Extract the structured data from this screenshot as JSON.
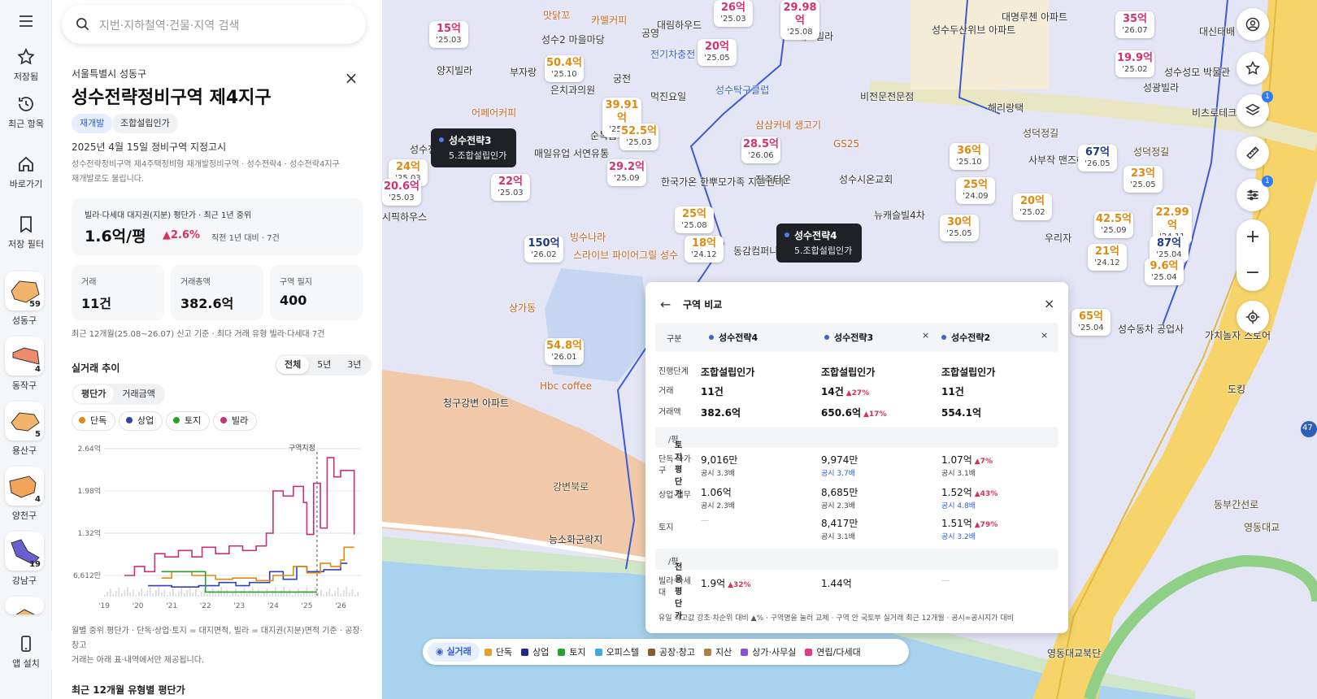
{
  "rail": {
    "menu_icon": "menu-icon",
    "items": [
      {
        "icon": "star-icon",
        "label": "저장됨"
      },
      {
        "icon": "history-icon",
        "label": "최근 항목"
      },
      {
        "icon": "home-icon",
        "label": "바로가기"
      },
      {
        "icon": "bookmark-icon",
        "label": "저장 필터"
      }
    ],
    "regions": [
      {
        "label": "성동구",
        "count": "59",
        "color": "#f2b46a"
      },
      {
        "label": "동작구",
        "count": "4",
        "color": "#f08a6c"
      },
      {
        "label": "용산구",
        "count": "5",
        "color": "#f2b46a"
      },
      {
        "label": "양천구",
        "count": "4",
        "color": "#f2a45a"
      },
      {
        "label": "강남구",
        "count": "19",
        "color": "#6a5fd0"
      }
    ],
    "app_install": "앱 설치"
  },
  "search": {
    "placeholder": "지번·지하철역·건물·지역 검색"
  },
  "detail": {
    "region": "서울특별시 성동구",
    "title": "성수전략정비구역 제4지구",
    "tags": [
      "재개발",
      "조합설립인가"
    ],
    "designated": "2025년 4월 15일 정비구역 지정고시",
    "alias_line1": "성수전략정비구역 제4주택정비형 재개발정비구역 · 성수전략4 · 성수전략4지구",
    "alias_line2": "재개발로도 불립니다.",
    "price_label": "빌라·다세대 대지권(지분) 평단가 · 최근 1년 중위",
    "price_value": "1.6억/평",
    "price_change": "▲2.6%",
    "price_compare": "직전 1년 대비 · 7건",
    "stats": [
      {
        "label": "거래",
        "value": "11건"
      },
      {
        "label": "거래총액",
        "value": "382.6억"
      },
      {
        "label": "구역 필지",
        "value": "400"
      }
    ],
    "note": "최근 12개월(25.08~26.07) 신고 기준 · 최다 거래 유형 빌라·다세대 7건",
    "trend_title": "실거래 추이",
    "period_tabs": [
      "전체",
      "5년",
      "3년"
    ],
    "metric_tabs": [
      "평단가",
      "거래금액"
    ],
    "legend": [
      {
        "name": "단독",
        "color": "#e08a0e"
      },
      {
        "name": "상업",
        "color": "#3340b8"
      },
      {
        "name": "토지",
        "color": "#2aa12a"
      },
      {
        "name": "빌라",
        "color": "#c8307a"
      }
    ],
    "foot_line1": "월별 중위 평단가 · 단독·상업·토지 = 대지면적, 빌라 = 대지권(지분)면적 기준 · 공장·창고",
    "foot_line2": "거래는 아래 표·내역에서만 제공됩니다.",
    "bottom_heading": "최근 12개월 유형별 평단가"
  },
  "chart_data": {
    "type": "line",
    "x_ticks": [
      "'19",
      "'20",
      "'21",
      "'22",
      "'23",
      "'24",
      "'25",
      "'26"
    ],
    "y_ticks": [
      "2.64억",
      "1.98억",
      "1.32억",
      "6,612만"
    ],
    "ylim": [
      0.33,
      2.64
    ],
    "annotation": "구역지정",
    "annotation_x": 2025.3,
    "series": [
      {
        "name": "빌라",
        "color": "#c8307a",
        "points": [
          [
            2019.6,
            0.66
          ],
          [
            2019.9,
            0.8
          ],
          [
            2020.2,
            0.72
          ],
          [
            2020.5,
            1.0
          ],
          [
            2020.8,
            0.95
          ],
          [
            2021.2,
            1.05
          ],
          [
            2021.6,
            0.95
          ],
          [
            2021.9,
            1.1
          ],
          [
            2022.3,
            1.0
          ],
          [
            2022.7,
            1.12
          ],
          [
            2023.1,
            1.05
          ],
          [
            2023.5,
            1.12
          ],
          [
            2023.8,
            1.32
          ],
          [
            2024.0,
            1.98
          ],
          [
            2024.3,
            1.9
          ],
          [
            2024.6,
            2.05
          ],
          [
            2024.9,
            1.8
          ],
          [
            2025.0,
            1.3
          ],
          [
            2025.2,
            2.1
          ],
          [
            2025.4,
            1.4
          ],
          [
            2025.6,
            2.5
          ],
          [
            2025.8,
            2.2
          ],
          [
            2026.0,
            2.3
          ],
          [
            2026.3,
            2.3
          ],
          [
            2026.4,
            1.3
          ]
        ]
      },
      {
        "name": "상업",
        "color": "#3340b8",
        "points": [
          [
            2020.3,
            0.5
          ],
          [
            2021.0,
            0.48
          ],
          [
            2021.8,
            0.5
          ],
          [
            2022.4,
            0.55
          ],
          [
            2022.9,
            0.5
          ],
          [
            2023.3,
            0.55
          ],
          [
            2023.9,
            0.72
          ],
          [
            2024.3,
            0.6
          ],
          [
            2024.7,
            0.8
          ],
          [
            2025.0,
            0.72
          ],
          [
            2025.5,
            0.75
          ],
          [
            2026.0,
            0.85
          ],
          [
            2026.2,
            0.85
          ]
        ]
      },
      {
        "name": "단독",
        "color": "#e08a0e",
        "points": [
          [
            2020.7,
            0.62
          ],
          [
            2021.0,
            0.72
          ],
          [
            2021.6,
            0.66
          ],
          [
            2022.3,
            0.6
          ],
          [
            2022.8,
            0.62
          ],
          [
            2023.5,
            0.58
          ],
          [
            2024.0,
            0.66
          ],
          [
            2024.6,
            0.8
          ],
          [
            2025.0,
            0.7
          ],
          [
            2025.4,
            0.85
          ],
          [
            2025.7,
            0.8
          ],
          [
            2026.0,
            0.9
          ],
          [
            2026.1,
            1.1
          ],
          [
            2026.4,
            1.1
          ]
        ]
      },
      {
        "name": "토지",
        "color": "#2aa12a",
        "points": [
          [
            2020.7,
            0.72
          ],
          [
            2021.4,
            0.72
          ],
          [
            2021.9,
            0.72
          ],
          [
            2022.0,
            0.4
          ],
          [
            2024.1,
            0.4
          ],
          [
            2025.3,
            0.4
          ]
        ]
      }
    ]
  },
  "map": {
    "places": [
      {
        "t": "양지빌라",
        "c": ""
      },
      {
        "t": "부자랑",
        "c": ""
      },
      {
        "t": "성수2 마을마당",
        "c": ""
      },
      {
        "t": "공영",
        "c": ""
      },
      {
        "t": "대림하우드",
        "c": ""
      },
      {
        "t": "대보빌라",
        "c": ""
      },
      {
        "t": "전기차충전",
        "c": "blue"
      },
      {
        "t": "궁전",
        "c": ""
      },
      {
        "t": "은치과의원",
        "c": ""
      },
      {
        "t": "먹진요일",
        "c": ""
      },
      {
        "t": "성수탁구클럽",
        "c": "blue"
      },
      {
        "t": "어페어커피",
        "c": "orange"
      },
      {
        "t": "매일유업 서연유통",
        "c": ""
      },
      {
        "t": "한국가온 한뿌모가족 지원센터",
        "c": ""
      },
      {
        "t": "진주타운",
        "c": ""
      },
      {
        "t": "성수시온교회",
        "c": ""
      },
      {
        "t": "뉴캐슬빌4차",
        "c": ""
      },
      {
        "t": "비전문전문점",
        "c": ""
      },
      {
        "t": "해리랑택",
        "c": ""
      },
      {
        "t": "성덕정길",
        "c": "road"
      },
      {
        "t": "사부작 맨즈헤어",
        "c": ""
      },
      {
        "t": "동감컴퍼니",
        "c": ""
      },
      {
        "t": "빙수나라",
        "c": "orange"
      },
      {
        "t": "상가동",
        "c": "orange"
      },
      {
        "t": "청구강변 아파트",
        "c": ""
      },
      {
        "t": "Hbc coffee",
        "c": "orange"
      },
      {
        "t": "강변북로",
        "c": "road"
      },
      {
        "t": "능소화군락지",
        "c": ""
      },
      {
        "t": "유원연",
        "c": ""
      },
      {
        "t": "대명루첸 아파트",
        "c": ""
      },
      {
        "t": "성수두산위브 아파트",
        "c": ""
      },
      {
        "t": "대신태배",
        "c": ""
      },
      {
        "t": "성수성모 박물관",
        "c": ""
      },
      {
        "t": "성광빌라",
        "c": ""
      },
      {
        "t": "비츠로테크",
        "c": ""
      },
      {
        "t": "성덕정길",
        "c": "road"
      },
      {
        "t": "우리자",
        "c": ""
      },
      {
        "t": "가치놀자 스토어",
        "c": ""
      },
      {
        "t": "동부간선로",
        "c": "road"
      },
      {
        "t": "영동대교북단",
        "c": ""
      },
      {
        "t": "성수동차 공업사",
        "c": ""
      },
      {
        "t": "GS25",
        "c": "orange"
      },
      {
        "t": "카멜커피",
        "c": "orange"
      },
      {
        "t": "맛닭꼬",
        "c": "orange"
      },
      {
        "t": "삼삼커네 생고기",
        "c": "orange"
      },
      {
        "t": "스라이브 파이어그릴 성수",
        "c": "orange"
      },
      {
        "t": "순복음 하나교회",
        "c": ""
      },
      {
        "t": "성수전략비구",
        "c": ""
      },
      {
        "t": "시픽하우스",
        "c": ""
      },
      {
        "t": "영동대교",
        "c": "road"
      },
      {
        "t": "도킹",
        "c": ""
      }
    ],
    "pins": [
      {
        "v": "15억",
        "d": "'25.03",
        "c": "pink"
      },
      {
        "v": "29.98억",
        "d": "'25.08",
        "c": "pink"
      },
      {
        "v": "26억",
        "d": "'25.03",
        "c": "pink"
      },
      {
        "v": "50.4억",
        "d": "'25.10",
        "c": "orange"
      },
      {
        "v": "20억",
        "d": "'25.05",
        "c": "pink"
      },
      {
        "v": "39.91억",
        "d": "'25.06",
        "c": "orange"
      },
      {
        "v": "52.5억",
        "d": "'25.03",
        "c": "orange"
      },
      {
        "v": "28.5억",
        "d": "'26.06",
        "c": "pink"
      },
      {
        "v": "29.2억",
        "d": "'25.09",
        "c": "pink"
      },
      {
        "v": "24억",
        "d": "'25.03",
        "c": "orange"
      },
      {
        "v": "20.6억",
        "d": "'25.03",
        "c": "pink"
      },
      {
        "v": "22억",
        "d": "'25.03",
        "c": "pink"
      },
      {
        "v": "25억",
        "d": "'25.08",
        "c": "orange"
      },
      {
        "v": "18억",
        "d": "'24.12",
        "c": "orange"
      },
      {
        "v": "150억",
        "d": "'26.02",
        "c": "navy"
      },
      {
        "v": "54.8억",
        "d": "'26.01",
        "c": "orange"
      },
      {
        "v": "36억",
        "d": "'25.10",
        "c": "orange"
      },
      {
        "v": "67억",
        "d": "'26.05",
        "c": "navy"
      },
      {
        "v": "25억",
        "d": "'24.09",
        "c": "orange"
      },
      {
        "v": "20억",
        "d": "'25.02",
        "c": "orange"
      },
      {
        "v": "30억",
        "d": "'25.05",
        "c": "orange"
      },
      {
        "v": "42.5억",
        "d": "'25.09",
        "c": "orange"
      },
      {
        "v": "23억",
        "d": "'25.05",
        "c": "orange"
      },
      {
        "v": "22.99억",
        "d": "'24.11",
        "c": "orange"
      },
      {
        "v": "21억",
        "d": "'24.12",
        "c": "orange"
      },
      {
        "v": "87억",
        "d": "'25.04",
        "c": "navy"
      },
      {
        "v": "9.6억",
        "d": "'25.04",
        "c": "orange"
      },
      {
        "v": "35억",
        "d": "'26.07",
        "c": "pink"
      },
      {
        "v": "19.9억",
        "d": "'25.02",
        "c": "pink"
      },
      {
        "v": "65억",
        "d": "'25.04",
        "c": "orange"
      }
    ],
    "tips": [
      {
        "name": "성수전략3",
        "sub": "5.조합설립인가"
      },
      {
        "name": "성수전략4",
        "sub": "5.조합설립인가"
      }
    ],
    "road_badge": "47"
  },
  "tools": [
    "user-icon",
    "star-icon",
    "layers-icon",
    "ruler-icon",
    "filter-icon",
    "locate-icon"
  ],
  "zoom": {
    "in": "+",
    "out": "−"
  },
  "compare": {
    "title": "구역 비교",
    "col_head": "구분",
    "cols": [
      "성수전략4",
      "성수전략3",
      "성수전략2"
    ],
    "stage_label": "진행단계",
    "stage": [
      "조합설립인가",
      "조합설립인가",
      "조합설립인가"
    ],
    "deals_label": "거래",
    "deals": [
      "11건",
      "14건",
      "11건"
    ],
    "deals_up": [
      "",
      "▲27%",
      ""
    ],
    "amount_label": "거래액",
    "amount": [
      "382.6억",
      "650.6억",
      "554.1억"
    ],
    "amount_up": [
      "",
      "▲17%",
      ""
    ],
    "land_sec": "토지 평단가",
    "land_unit": "/평",
    "rows": [
      {
        "label": "단독·다가구",
        "v": [
          "9,016만",
          "9,974만",
          "1.07억"
        ],
        "up": [
          "",
          "",
          "▲7%"
        ],
        "s": [
          "공시 3.3배",
          "공시 3.7배",
          "공시 3.1배"
        ]
      },
      {
        "label": "상업·업무",
        "v": [
          "1.06억",
          "8,685만",
          "1.52억"
        ],
        "up": [
          "",
          "",
          "▲43%"
        ],
        "s": [
          "공시 2.3배",
          "공시 2.3배",
          "공시 4.8배"
        ]
      },
      {
        "label": "토지",
        "v": [
          "—",
          "8,417만",
          "1.51억"
        ],
        "up": [
          "",
          "",
          "▲79%"
        ],
        "s": [
          "",
          "공시 3.1배",
          "공시 3.2배"
        ]
      }
    ],
    "excl_sec": "전용 평단가",
    "excl_unit": "/평",
    "villa_label": "빌라·다세대",
    "villa": [
      "1.9억",
      "1.44억",
      "—"
    ],
    "villa_up": [
      "▲32%",
      "",
      ""
    ],
    "footnote": "유일 최고값 강조·차순위 대비 ▲% · 구역명을 눌러 교체 · 구역 안 국토부 실거래 최근 12개월 · 공시=공시지가 대비"
  },
  "legend_bar": {
    "live": "실거래",
    "items": [
      {
        "name": "단독",
        "color": "#e8a02a"
      },
      {
        "name": "상업",
        "color": "#1f2a8a"
      },
      {
        "name": "토지",
        "color": "#2aa12a"
      },
      {
        "name": "오피스텔",
        "color": "#3fa9e6"
      },
      {
        "name": "공장·창고",
        "color": "#8a5a2a"
      },
      {
        "name": "지산",
        "color": "#b08040"
      },
      {
        "name": "상가·사무실",
        "color": "#8a4fd8"
      },
      {
        "name": "연립/다세대",
        "color": "#e03a8a"
      }
    ]
  }
}
